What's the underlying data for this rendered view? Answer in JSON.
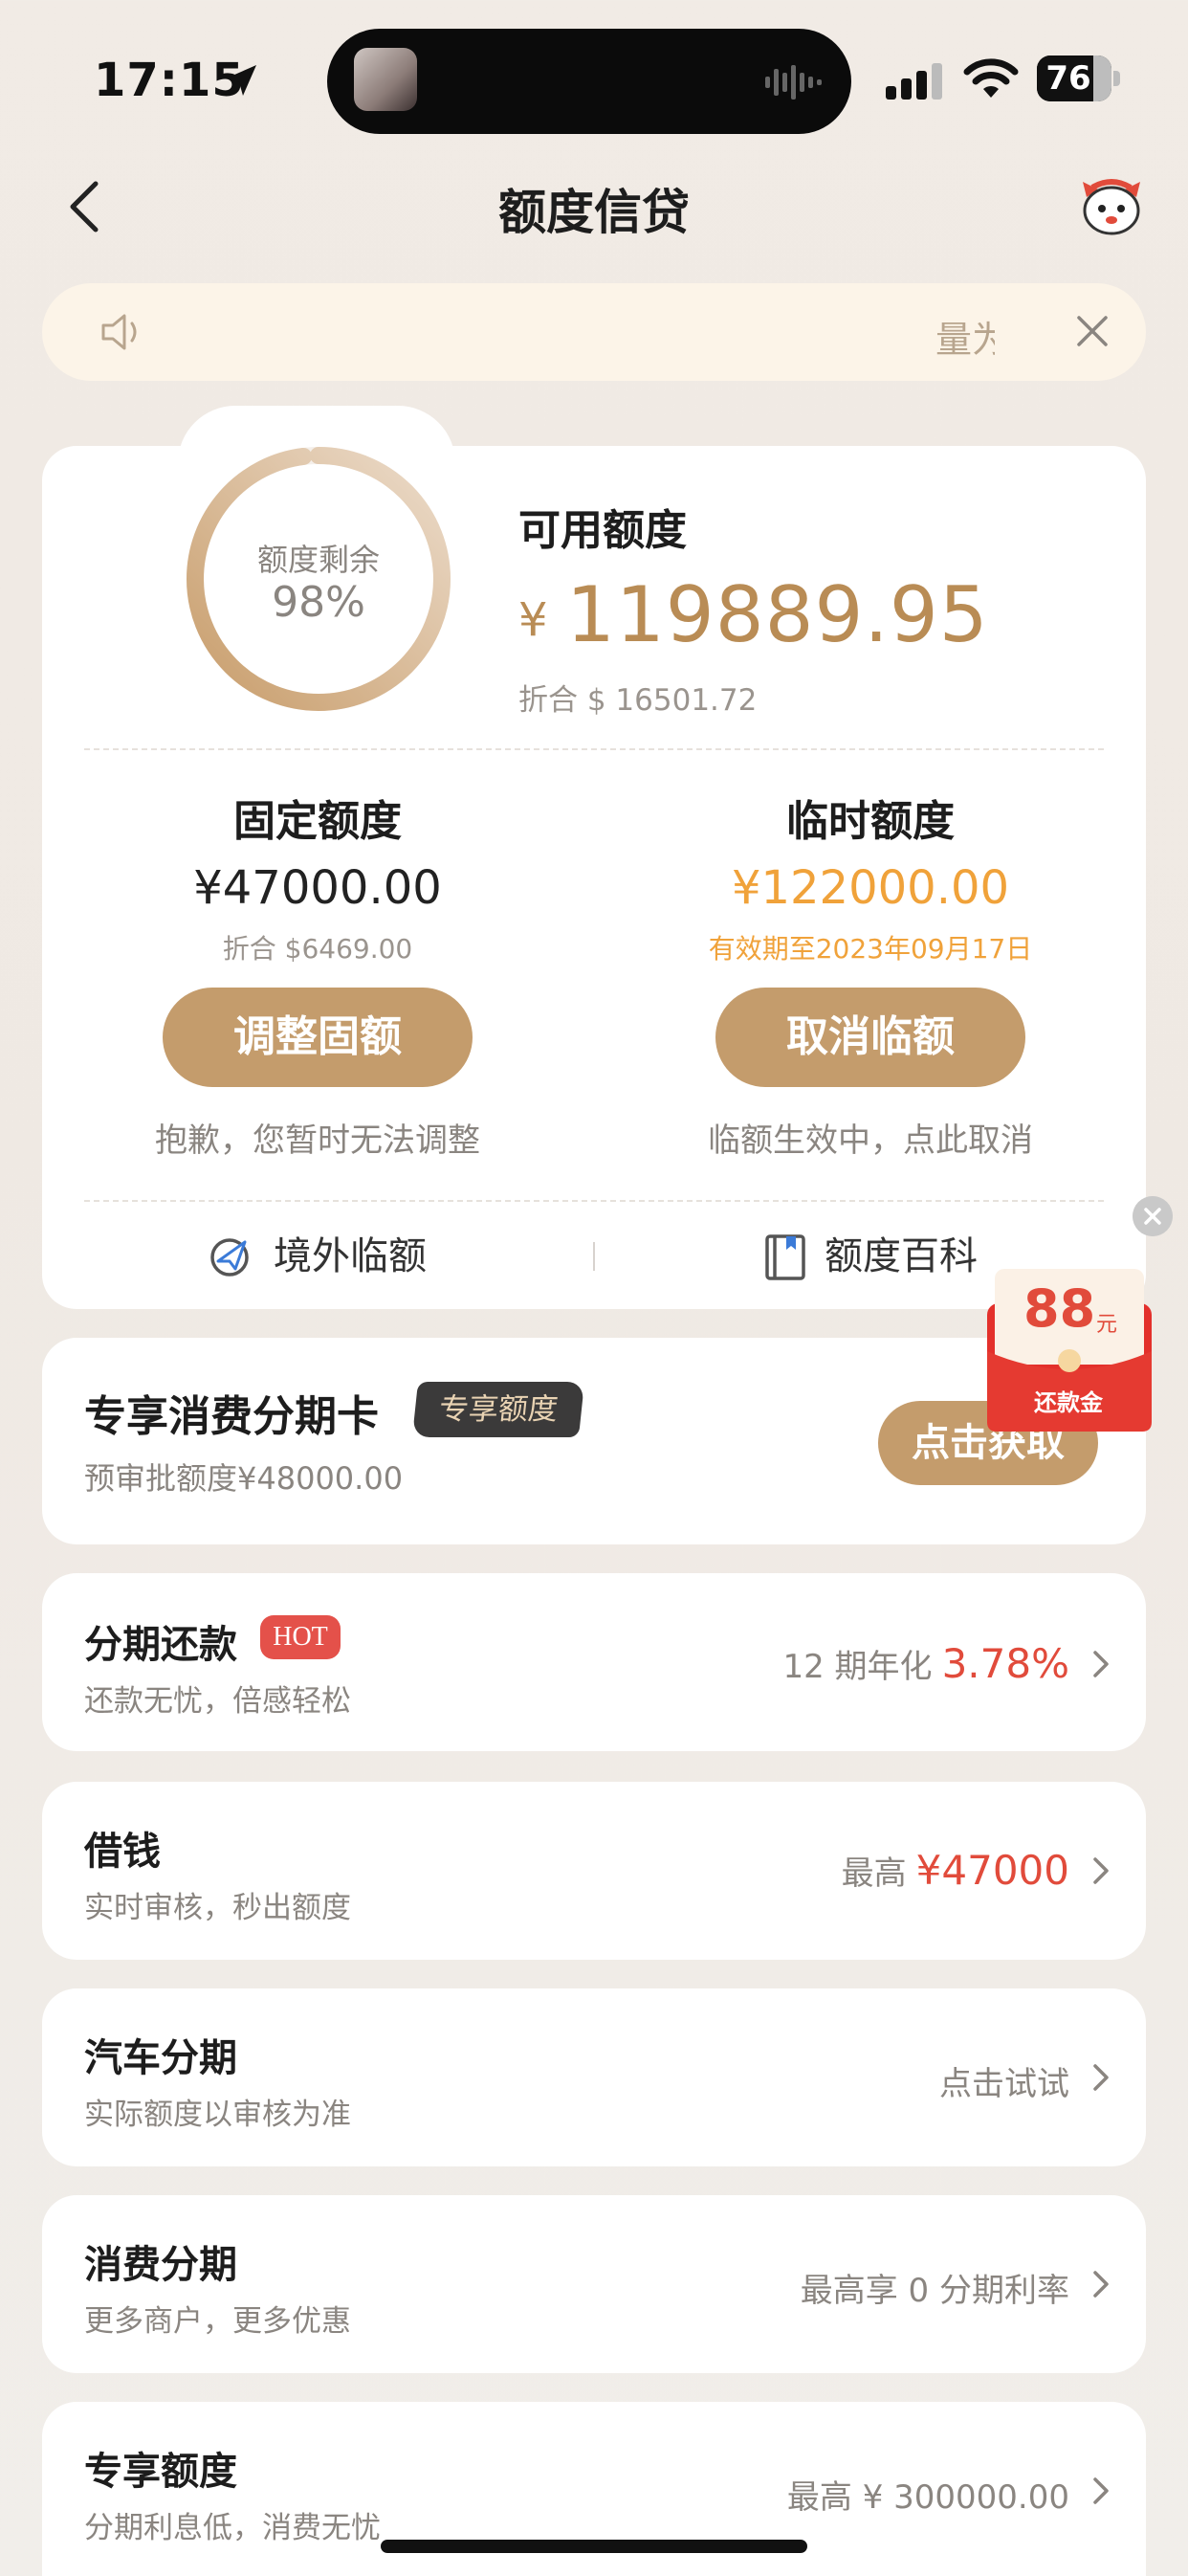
{
  "status": {
    "time": "17:15",
    "battery": "76",
    "battery_level": 0.76
  },
  "nav": {
    "title": "额度信贷",
    "back_icon": "chevron-left-icon",
    "mascot_icon": "mascot-icon"
  },
  "notice": {
    "text": "量为",
    "speaker_icon": "speaker-icon",
    "close_icon": "close-icon"
  },
  "credit": {
    "ring_label": "额度剩余",
    "ring_value": "98%",
    "ring_fraction": 0.98,
    "available_label": "可用额度",
    "currency_symbol": "¥",
    "available_amount": "119889.95",
    "converted": "折合 $ 16501.72",
    "fixed": {
      "title": "固定额度",
      "amount": "¥47000.00",
      "sub": "折合 $6469.00",
      "button": "调整固额",
      "hint": "抱歉，您暂时无法调整"
    },
    "temp": {
      "title": "临时额度",
      "amount": "¥122000.00",
      "sub": "有效期至2023年09月17日",
      "button": "取消临额",
      "hint": "临额生效中，点此取消"
    },
    "links": {
      "overseas": "境外临额",
      "wiki": "额度百科"
    }
  },
  "exclusive": {
    "title": "专享消费分期卡",
    "badge": "专享额度",
    "sub": "预审批额度¥48000.00",
    "button": "点击获取"
  },
  "float_envelope": {
    "amount": "88",
    "unit": "元",
    "label": "还款金"
  },
  "rows": [
    {
      "title": "分期还款",
      "badge": "HOT",
      "sub": "还款无忧，倍感轻松",
      "right_text": "12 期年化",
      "right_highlight": "3.78%"
    },
    {
      "title": "借钱",
      "sub": "实时审核，秒出额度",
      "right_text": "最高",
      "right_highlight": "¥47000"
    },
    {
      "title": "汽车分期",
      "sub": "实际额度以审核为准",
      "right_text": "点击试试",
      "right_highlight": ""
    },
    {
      "title": "消费分期",
      "sub": "更多商户，更多优惠",
      "right_text": "最高享 0 分期利率",
      "right_highlight": ""
    },
    {
      "title": "专享额度",
      "sub": "分期利息低，消费无忧",
      "right_text": "最高 ¥ 300000.00",
      "right_highlight": ""
    }
  ],
  "colors": {
    "accent": "#c49c6c",
    "gold_text": "#b98c55",
    "temp_amount": "#f0a23a",
    "highlight_red": "#e14b3b",
    "background": "#f1ebe5"
  }
}
